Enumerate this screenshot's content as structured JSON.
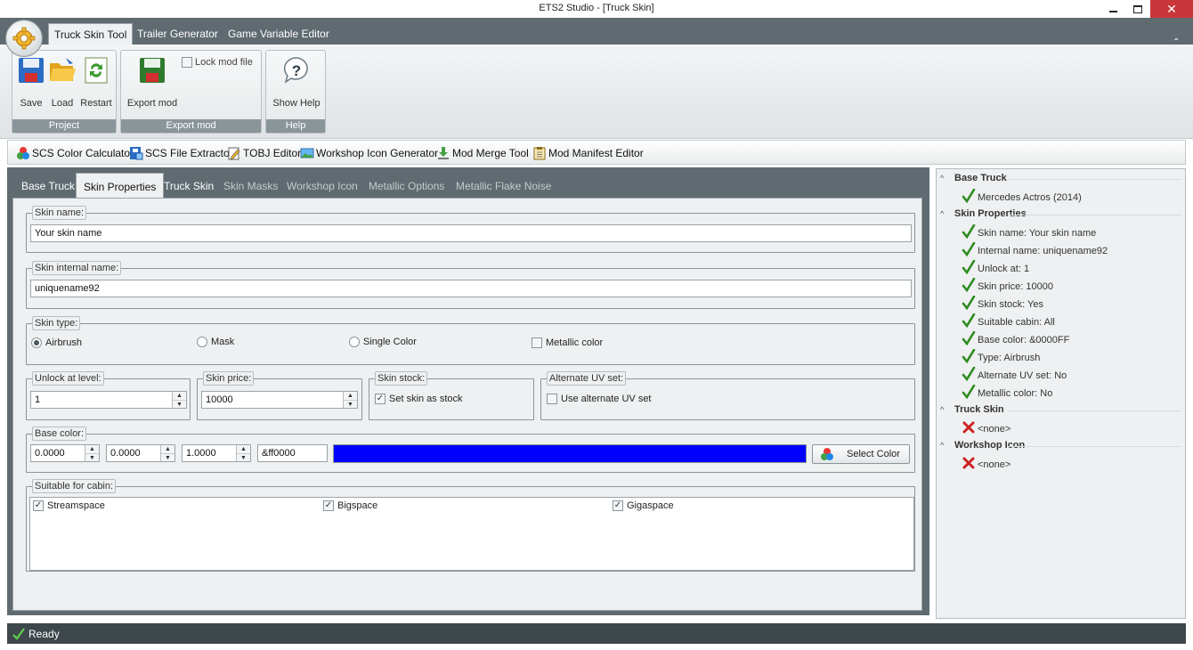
{
  "window": {
    "title": "ETS2 Studio - [Truck Skin]"
  },
  "ribbon": {
    "tabs": [
      "Truck Skin Tool",
      "Trailer Generator",
      "Game Variable Editor"
    ],
    "active_tab": "Truck Skin Tool",
    "groups": {
      "project": {
        "label": "Project",
        "save": "Save",
        "load": "Load",
        "restart": "Restart"
      },
      "export": {
        "label": "Export mod",
        "export": "Export mod",
        "lock": "Lock mod file"
      },
      "help": {
        "label": "Help",
        "show_help": "Show Help"
      }
    }
  },
  "tools": [
    "SCS Color Calculator",
    "SCS File Extractor",
    "TOBJ Editor",
    "Workshop Icon Generator",
    "Mod Merge Tool",
    "Mod Manifest Editor"
  ],
  "content_tabs": [
    "Base Truck",
    "Skin Properties",
    "Truck Skin",
    "Skin Masks",
    "Workshop Icon",
    "Metallic Options",
    "Metallic Flake Noise"
  ],
  "active_content_tab": "Skin Properties",
  "form": {
    "skin_name": {
      "label": "Skin name:",
      "value": "Your skin name"
    },
    "skin_internal_name": {
      "label": "Skin internal name:",
      "value": "uniquename92"
    },
    "skin_type": {
      "label": "Skin type:",
      "options": [
        "Airbrush",
        "Mask",
        "Single Color"
      ],
      "selected": "Airbrush",
      "metallic_label": "Metallic color",
      "metallic_checked": false
    },
    "unlock": {
      "label": "Unlock at level:",
      "value": "1"
    },
    "price": {
      "label": "Skin price:",
      "value": "10000"
    },
    "stock": {
      "label": "Skin stock:",
      "checkbox": "Set skin as stock",
      "checked": true
    },
    "alt_uv": {
      "label": "Alternate UV set:",
      "checkbox": "Use alternate UV set",
      "checked": false
    },
    "base_color": {
      "label": "Base color:",
      "r": "0.0000",
      "g": "0.0000",
      "b": "1.0000",
      "hex": "&ff0000",
      "preview_color": "#0000ff",
      "button": "Select Color"
    },
    "cabins": {
      "label": "Suitable for cabin:",
      "items": [
        {
          "label": "Streamspace",
          "checked": true
        },
        {
          "label": "Bigspace",
          "checked": true
        },
        {
          "label": "Gigaspace",
          "checked": true
        }
      ]
    }
  },
  "tree": {
    "sections": [
      {
        "title": "Base Truck",
        "items": [
          {
            "text": "Mercedes Actros (2014)",
            "ok": true
          }
        ]
      },
      {
        "title": "Skin Properties",
        "items": [
          {
            "text": "Skin name: Your skin name",
            "ok": true
          },
          {
            "text": "Internal name: uniquename92",
            "ok": true
          },
          {
            "text": "Unlock at: 1",
            "ok": true
          },
          {
            "text": "Skin price: 10000",
            "ok": true
          },
          {
            "text": "Skin stock: Yes",
            "ok": true
          },
          {
            "text": "Suitable cabin: All",
            "ok": true
          },
          {
            "text": "Base color: &0000FF",
            "ok": true
          },
          {
            "text": "Type: Airbrush",
            "ok": true
          },
          {
            "text": "Alternate UV set: No",
            "ok": true
          },
          {
            "text": "Metallic color: No",
            "ok": true
          }
        ]
      },
      {
        "title": "Truck Skin",
        "items": [
          {
            "text": "<none>",
            "ok": false
          }
        ]
      },
      {
        "title": "Workshop Icon",
        "items": [
          {
            "text": "<none>",
            "ok": false
          }
        ]
      }
    ]
  },
  "status": {
    "text": "Ready"
  },
  "colors": {
    "accent_green": "#2e8b1f",
    "error_red": "#cc2222",
    "chrome": "#5f6b70",
    "preview_blue": "#0000ff"
  }
}
